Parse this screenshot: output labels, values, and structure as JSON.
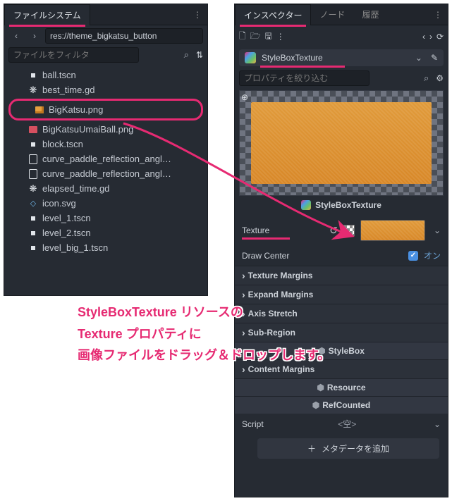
{
  "filesystem": {
    "tab_label": "ファイルシステム",
    "path": "res://theme_bigkatsu_button",
    "filter_placeholder": "ファイルをフィルタ",
    "files": [
      {
        "name": "ball.tscn",
        "icon": "scene"
      },
      {
        "name": "best_time.gd",
        "icon": "gear"
      },
      {
        "name": "BigKatsu.png",
        "icon": "image",
        "highlight": true
      },
      {
        "name": "BigKatsuUmaiBall.png",
        "icon": "image-r"
      },
      {
        "name": "block.tscn",
        "icon": "scene"
      },
      {
        "name": "curve_paddle_reflection_angl…",
        "icon": "script"
      },
      {
        "name": "curve_paddle_reflection_angl…",
        "icon": "script"
      },
      {
        "name": "elapsed_time.gd",
        "icon": "gear"
      },
      {
        "name": "icon.svg",
        "icon": "svg"
      },
      {
        "name": "level_1.tscn",
        "icon": "scene"
      },
      {
        "name": "level_2.tscn",
        "icon": "scene"
      },
      {
        "name": "level_big_1.tscn",
        "icon": "scene"
      }
    ]
  },
  "inspector": {
    "tab_inspector": "インスペクター",
    "tab_node": "ノード",
    "tab_history": "履歴",
    "resource_name": "StyleBoxTexture",
    "filter_placeholder": "プロパティを絞り込む",
    "preview_caption": "StyleBoxTexture",
    "prop_texture": "Texture",
    "prop_draw_center": "Draw Center",
    "draw_center_on": "オン",
    "sections": {
      "texture_margins": "Texture Margins",
      "expand_margins": "Expand Margins",
      "axis_stretch": "Axis Stretch",
      "sub_region": "Sub-Region",
      "stylebox": "StyleBox",
      "content_margins": "Content Margins",
      "resource": "Resource",
      "refcounted": "RefCounted"
    },
    "script_label": "Script",
    "script_value": "<空>",
    "add_metadata": "メタデータを追加"
  },
  "annotation": {
    "line1": "StyleBoxTexture リソースの",
    "line2": "Texture プロパティに",
    "line3": "画像ファイルをドラッグ＆ドロップします。"
  }
}
